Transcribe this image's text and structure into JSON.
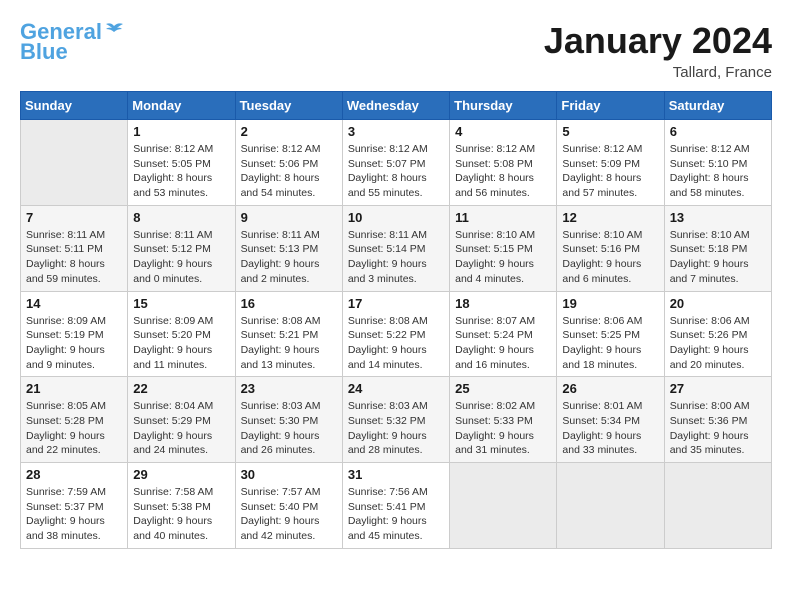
{
  "header": {
    "logo_line1": "General",
    "logo_line2": "Blue",
    "month_title": "January 2024",
    "location": "Tallard, France"
  },
  "days_of_week": [
    "Sunday",
    "Monday",
    "Tuesday",
    "Wednesday",
    "Thursday",
    "Friday",
    "Saturday"
  ],
  "weeks": [
    [
      {
        "day": "",
        "empty": true
      },
      {
        "day": "1",
        "sunrise": "8:12 AM",
        "sunset": "5:05 PM",
        "daylight": "8 hours and 53 minutes."
      },
      {
        "day": "2",
        "sunrise": "8:12 AM",
        "sunset": "5:06 PM",
        "daylight": "8 hours and 54 minutes."
      },
      {
        "day": "3",
        "sunrise": "8:12 AM",
        "sunset": "5:07 PM",
        "daylight": "8 hours and 55 minutes."
      },
      {
        "day": "4",
        "sunrise": "8:12 AM",
        "sunset": "5:08 PM",
        "daylight": "8 hours and 56 minutes."
      },
      {
        "day": "5",
        "sunrise": "8:12 AM",
        "sunset": "5:09 PM",
        "daylight": "8 hours and 57 minutes."
      },
      {
        "day": "6",
        "sunrise": "8:12 AM",
        "sunset": "5:10 PM",
        "daylight": "8 hours and 58 minutes."
      }
    ],
    [
      {
        "day": "7",
        "sunrise": "8:11 AM",
        "sunset": "5:11 PM",
        "daylight": "8 hours and 59 minutes."
      },
      {
        "day": "8",
        "sunrise": "8:11 AM",
        "sunset": "5:12 PM",
        "daylight": "9 hours and 0 minutes."
      },
      {
        "day": "9",
        "sunrise": "8:11 AM",
        "sunset": "5:13 PM",
        "daylight": "9 hours and 2 minutes."
      },
      {
        "day": "10",
        "sunrise": "8:11 AM",
        "sunset": "5:14 PM",
        "daylight": "9 hours and 3 minutes."
      },
      {
        "day": "11",
        "sunrise": "8:10 AM",
        "sunset": "5:15 PM",
        "daylight": "9 hours and 4 minutes."
      },
      {
        "day": "12",
        "sunrise": "8:10 AM",
        "sunset": "5:16 PM",
        "daylight": "9 hours and 6 minutes."
      },
      {
        "day": "13",
        "sunrise": "8:10 AM",
        "sunset": "5:18 PM",
        "daylight": "9 hours and 7 minutes."
      }
    ],
    [
      {
        "day": "14",
        "sunrise": "8:09 AM",
        "sunset": "5:19 PM",
        "daylight": "9 hours and 9 minutes."
      },
      {
        "day": "15",
        "sunrise": "8:09 AM",
        "sunset": "5:20 PM",
        "daylight": "9 hours and 11 minutes."
      },
      {
        "day": "16",
        "sunrise": "8:08 AM",
        "sunset": "5:21 PM",
        "daylight": "9 hours and 13 minutes."
      },
      {
        "day": "17",
        "sunrise": "8:08 AM",
        "sunset": "5:22 PM",
        "daylight": "9 hours and 14 minutes."
      },
      {
        "day": "18",
        "sunrise": "8:07 AM",
        "sunset": "5:24 PM",
        "daylight": "9 hours and 16 minutes."
      },
      {
        "day": "19",
        "sunrise": "8:06 AM",
        "sunset": "5:25 PM",
        "daylight": "9 hours and 18 minutes."
      },
      {
        "day": "20",
        "sunrise": "8:06 AM",
        "sunset": "5:26 PM",
        "daylight": "9 hours and 20 minutes."
      }
    ],
    [
      {
        "day": "21",
        "sunrise": "8:05 AM",
        "sunset": "5:28 PM",
        "daylight": "9 hours and 22 minutes."
      },
      {
        "day": "22",
        "sunrise": "8:04 AM",
        "sunset": "5:29 PM",
        "daylight": "9 hours and 24 minutes."
      },
      {
        "day": "23",
        "sunrise": "8:03 AM",
        "sunset": "5:30 PM",
        "daylight": "9 hours and 26 minutes."
      },
      {
        "day": "24",
        "sunrise": "8:03 AM",
        "sunset": "5:32 PM",
        "daylight": "9 hours and 28 minutes."
      },
      {
        "day": "25",
        "sunrise": "8:02 AM",
        "sunset": "5:33 PM",
        "daylight": "9 hours and 31 minutes."
      },
      {
        "day": "26",
        "sunrise": "8:01 AM",
        "sunset": "5:34 PM",
        "daylight": "9 hours and 33 minutes."
      },
      {
        "day": "27",
        "sunrise": "8:00 AM",
        "sunset": "5:36 PM",
        "daylight": "9 hours and 35 minutes."
      }
    ],
    [
      {
        "day": "28",
        "sunrise": "7:59 AM",
        "sunset": "5:37 PM",
        "daylight": "9 hours and 38 minutes."
      },
      {
        "day": "29",
        "sunrise": "7:58 AM",
        "sunset": "5:38 PM",
        "daylight": "9 hours and 40 minutes."
      },
      {
        "day": "30",
        "sunrise": "7:57 AM",
        "sunset": "5:40 PM",
        "daylight": "9 hours and 42 minutes."
      },
      {
        "day": "31",
        "sunrise": "7:56 AM",
        "sunset": "5:41 PM",
        "daylight": "9 hours and 45 minutes."
      },
      {
        "day": "",
        "empty": true
      },
      {
        "day": "",
        "empty": true
      },
      {
        "day": "",
        "empty": true
      }
    ]
  ]
}
